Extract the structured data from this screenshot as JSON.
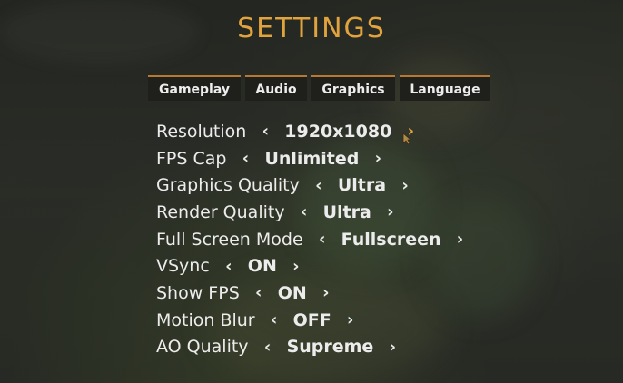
{
  "title": "SETTINGS",
  "tabs": [
    "Gameplay",
    "Audio",
    "Graphics",
    "Language"
  ],
  "accent_color": "#e0a33e",
  "settings": [
    {
      "label": "Resolution",
      "value": "1920x1080"
    },
    {
      "label": "FPS Cap",
      "value": "Unlimited"
    },
    {
      "label": "Graphics Quality",
      "value": "Ultra"
    },
    {
      "label": "Render Quality",
      "value": "Ultra"
    },
    {
      "label": "Full Screen Mode",
      "value": "Fullscreen"
    },
    {
      "label": "VSync",
      "value": "ON"
    },
    {
      "label": "Show FPS",
      "value": "ON"
    },
    {
      "label": "Motion Blur",
      "value": "OFF"
    },
    {
      "label": "AO Quality",
      "value": "Supreme"
    }
  ],
  "icons": {
    "prev": "‹",
    "next": "›"
  }
}
